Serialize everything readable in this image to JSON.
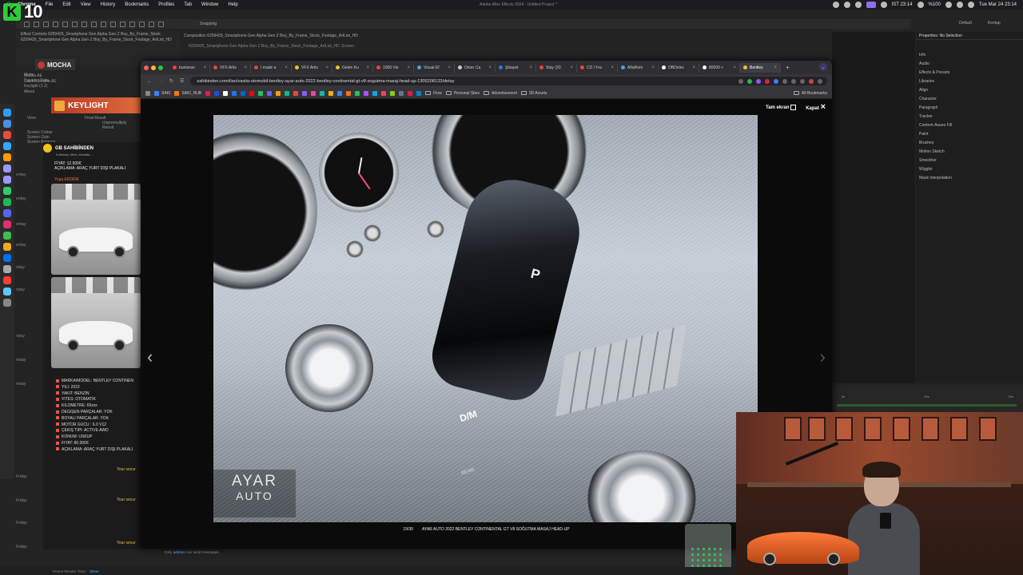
{
  "menubar": {
    "app": "Chrome",
    "items": [
      "File",
      "Edit",
      "View",
      "History",
      "Bookmarks",
      "Profiles",
      "Tab",
      "Window",
      "Help"
    ],
    "center_title": "Adobe After Effects 2024 - Untitled Project *",
    "time": "IST 23:14",
    "battery": "%100",
    "date": "Tue Mar 24  23:14"
  },
  "overlay": {
    "logo_letter": "K",
    "number": "10"
  },
  "ae": {
    "toolbar_snapping": "Snapping",
    "workspace_default": "Default",
    "workspace_keentap": "Keetap",
    "effect_controls_title": "Effect Controls 6259429_Smartphone Gen Alpha Gen Z Boy_By_Frame_Stock",
    "composition_title": "Composition 6259429_Smartphone Gen Alpha Gen Z Boy_By_Frame_Stock_Footage_ArtList_HD",
    "layer_line": "6259429_Smartphone Gen Alpha Gen Z Boy_By_Frame_Stock_Footage_ArtList_HD",
    "screen_label": "Screen",
    "fx_rows": [
      "Mocha AE",
      "Launch Mocha AE",
      "Matte",
      "Tracking Data",
      "Keylight (1.2)",
      "About"
    ],
    "mocha_label": "MOCHA",
    "keylight_label": "KEYLIGHT",
    "keylight_rows": [
      "View",
      "Screen Colour",
      "Screen Gain",
      "Screen Balance"
    ],
    "keylight_final": "Final Result",
    "keylight_unpremult": "Unpremultiply Result",
    "properties_title": "Properties: No Selection",
    "right_panels": [
      "Info",
      "Audio",
      "Effects & Presets",
      "Libraries",
      "Align",
      "Character",
      "Paragraph",
      "Tracker",
      "Content-Aware Fill",
      "Paint",
      "Brushes",
      "Motion Sketch",
      "Smoother",
      "Wiggler",
      "Mask Interpolation"
    ],
    "timeline_ticks": [
      "0s",
      "10s",
      "20s"
    ],
    "frame_render_label": "Frame Render Time:",
    "frame_render_value": "20ms"
  },
  "browser": {
    "tabs": [
      {
        "label": "bumeran",
        "color": "#e8453c"
      },
      {
        "label": "VFX Artis",
        "color": "#e8453c"
      },
      {
        "label": "I made a",
        "color": "#e8453c"
      },
      {
        "label": "VFX Artis",
        "color": "#f4c21c"
      },
      {
        "label": "Gelen Ku",
        "color": "#f4c21c"
      },
      {
        "label": "1000 Vie",
        "color": "#e8453c"
      },
      {
        "label": "Visual Ef",
        "color": "#4aa3df"
      },
      {
        "label": "Omer Ca",
        "color": "#cccccc"
      },
      {
        "label": "Şikayet",
        "color": "#2b7de9"
      },
      {
        "label": "Stay (20",
        "color": "#e8453c"
      },
      {
        "label": "CD / Fra",
        "color": "#e8453c"
      },
      {
        "label": "AlfaRom",
        "color": "#4aa3df"
      },
      {
        "label": "OBDelec",
        "color": "#ffffff"
      },
      {
        "label": "80000 +",
        "color": "#ffffff"
      },
      {
        "label": "Bentley",
        "color": "#f4c21c"
      }
    ],
    "url": "sahibinden.com/ilan/vasita-otomobil-bentley-ayar-auto-2022-bentley-continental-gt-v8-sogutma-masaj-head-up-1305208133/detay",
    "bookmarks": [
      {
        "label": "SAKI",
        "color": "#3b82f6"
      },
      {
        "label": "SAKI_HUB",
        "color": "#f97316"
      }
    ],
    "bookmark_folders": [
      "Flow",
      "Personal Sites",
      "Advertisement",
      "3D Assets"
    ],
    "all_bookmarks": "All Bookmarks",
    "bookmark_icon_colors": [
      "#e11d48",
      "#1d4ed8",
      "#ffffff",
      "#1877f2",
      "#0a66c2",
      "#ff0000",
      "#22c55e",
      "#6366f1",
      "#f59e0b",
      "#10b981",
      "#ef4444",
      "#8b5cf6",
      "#ec4899",
      "#14b8a6",
      "#eab308",
      "#3b82f6",
      "#f97316",
      "#22c55e",
      "#a855f7",
      "#0ea5e9",
      "#f43f5e",
      "#84cc16",
      "#64748b",
      "#e11d48",
      "#0284c7"
    ]
  },
  "gallery": {
    "fullscreen": "Tam ekran",
    "close": "Kapat",
    "counter": "19/30",
    "caption": "AYAR AUTO 2022 BENTLEY CONTINENTAL GT V8 SOĞUTMA MASAJ HEAD-UP",
    "watermark_line1": "AYAR",
    "watermark_line2": "AUTO",
    "shifter_letter": "P",
    "gear_label": "D/M",
    "rear_label": "REAR"
  },
  "listing": {
    "seller": "GB SAHİBİNDEN",
    "seller_sub": "Kutluhan, Mert, Mustafa, ...",
    "price_line": "FİYAT: 12.500€",
    "desc_line": "AÇIKLAMA: ARAÇ YURT DIŞI PLAKALI",
    "user": "Yuşa ERDEM",
    "specs": [
      "MARKA/MODEL: BENTLEY CONTINEN",
      "YILI: 2022",
      "YAKIT: BENZİN",
      "VİTES: OTOMATİK",
      "KİLOMETRE: 65xxx",
      "DEĞİŞEN PARÇALAR: YOK",
      "BOYALI PARÇALAR: YOK",
      "MOTOR GÜCÜ : 6.0 V12",
      "ÇEKİŞ TİPİ: ACTIVE AWD",
      "KONUM: ÜSKÜP",
      "FİYAT: 80.000€",
      "AÇIKLAMA: ARAÇ YURT DIŞI PLAKALI"
    ],
    "days": [
      "erday",
      "erday",
      "erday",
      "erday",
      "nday",
      "nday",
      "nday",
      "erday",
      "erday",
      "Friday",
      "Friday",
      "Friday",
      "Friday"
    ],
    "secure_text": "Your secur",
    "message_hint_prefix": "Only",
    "message_hint_link": "admins",
    "message_hint_suffix": "can send messages"
  }
}
